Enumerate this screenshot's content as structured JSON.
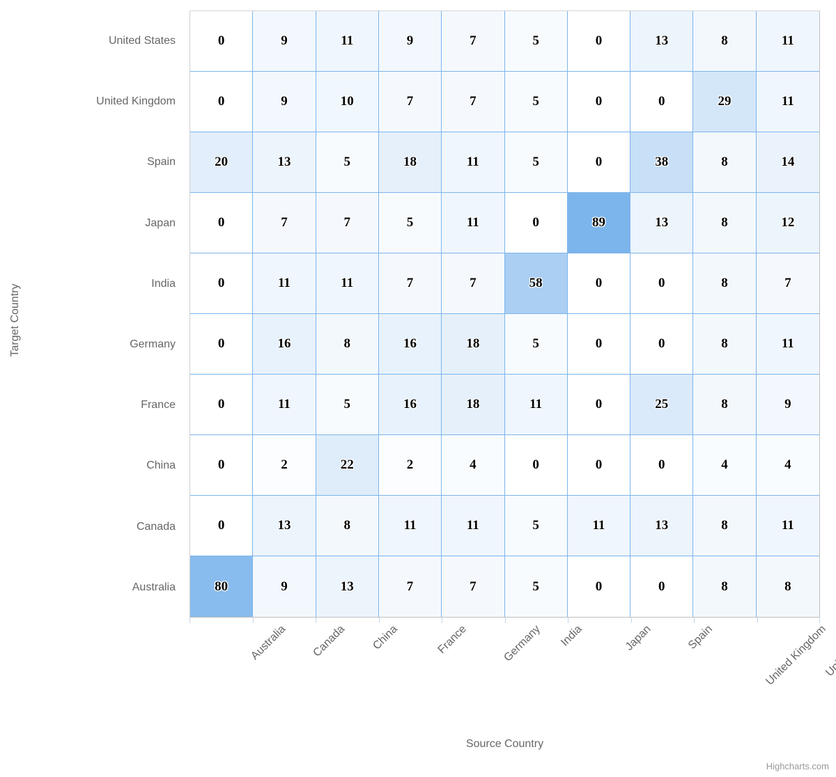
{
  "chart_data": {
    "type": "heatmap",
    "title": "",
    "xlabel": "Source Country",
    "ylabel": "Target Country",
    "x_categories": [
      "Australia",
      "Canada",
      "China",
      "France",
      "Germany",
      "India",
      "Japan",
      "Spain",
      "United Kingdom",
      "United States"
    ],
    "y_categories": [
      "United States",
      "United Kingdom",
      "Spain",
      "Japan",
      "India",
      "Germany",
      "France",
      "China",
      "Canada",
      "Australia"
    ],
    "grid": true,
    "legend": "none",
    "value_min": 0,
    "value_max": 89,
    "color_min": "#ffffff",
    "color_max": "#7cb5ec",
    "grid_line_color": "#7cb5ec",
    "axis_label_color": "#666666",
    "rows": [
      {
        "label": "United States",
        "values": [
          0,
          9,
          11,
          9,
          7,
          5,
          0,
          13,
          8,
          11
        ]
      },
      {
        "label": "United Kingdom",
        "values": [
          0,
          9,
          10,
          7,
          7,
          5,
          0,
          0,
          29,
          11
        ]
      },
      {
        "label": "Spain",
        "values": [
          20,
          13,
          5,
          18,
          11,
          5,
          0,
          38,
          8,
          14
        ]
      },
      {
        "label": "Japan",
        "values": [
          0,
          7,
          7,
          5,
          11,
          0,
          89,
          13,
          8,
          12
        ]
      },
      {
        "label": "India",
        "values": [
          0,
          11,
          11,
          7,
          7,
          58,
          0,
          0,
          8,
          7
        ]
      },
      {
        "label": "Germany",
        "values": [
          0,
          16,
          8,
          16,
          18,
          5,
          0,
          0,
          8,
          11
        ]
      },
      {
        "label": "France",
        "values": [
          0,
          11,
          5,
          16,
          18,
          11,
          0,
          25,
          8,
          9
        ]
      },
      {
        "label": "China",
        "values": [
          0,
          2,
          22,
          2,
          4,
          0,
          0,
          0,
          4,
          4
        ]
      },
      {
        "label": "Canada",
        "values": [
          0,
          13,
          8,
          11,
          11,
          5,
          11,
          13,
          8,
          11
        ]
      },
      {
        "label": "Australia",
        "values": [
          80,
          9,
          13,
          7,
          7,
          5,
          0,
          0,
          8,
          8
        ]
      }
    ]
  },
  "credits": {
    "text": "Highcharts.com"
  }
}
